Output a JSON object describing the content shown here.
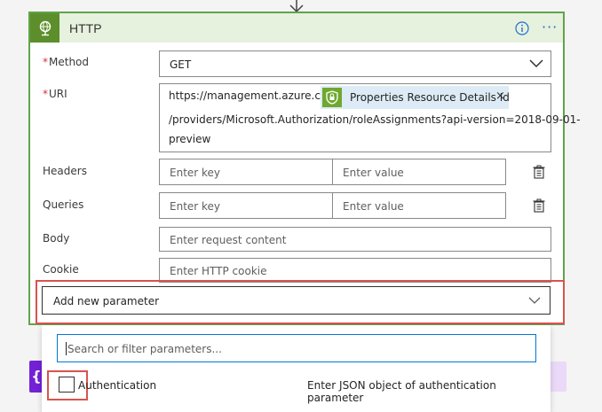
{
  "card": {
    "title": "HTTP",
    "info_icon": "info-icon",
    "more_label": "···"
  },
  "method": {
    "label": "Method",
    "required_mark": "*",
    "value": "GET"
  },
  "uri": {
    "label": "URI",
    "required_mark": "*",
    "prefix": "https://management.azure.com/",
    "token_label": "Properties Resource Details Id",
    "token_close": "×",
    "line2": "/providers/Microsoft.Authorization/roleAssignments?api-version=2018-09-01-",
    "line3": "preview"
  },
  "headers": {
    "label": "Headers",
    "key_placeholder": "Enter key",
    "value_placeholder": "Enter value"
  },
  "queries": {
    "label": "Queries",
    "key_placeholder": "Enter key",
    "value_placeholder": "Enter value"
  },
  "body": {
    "label": "Body",
    "placeholder": "Enter request content"
  },
  "cookie": {
    "label": "Cookie",
    "placeholder": "Enter HTTP cookie"
  },
  "add_param": {
    "label": "Add new parameter"
  },
  "param_panel": {
    "search_placeholder": "Search or filter parameters...",
    "option_label": "Authentication",
    "option_description": "Enter JSON object of authentication parameter",
    "option_checked": false
  },
  "colors": {
    "accent_green": "#60a44a",
    "header_bg": "#e6f1de",
    "highlight_red": "#d9534f",
    "focus_blue": "#0078d4"
  }
}
